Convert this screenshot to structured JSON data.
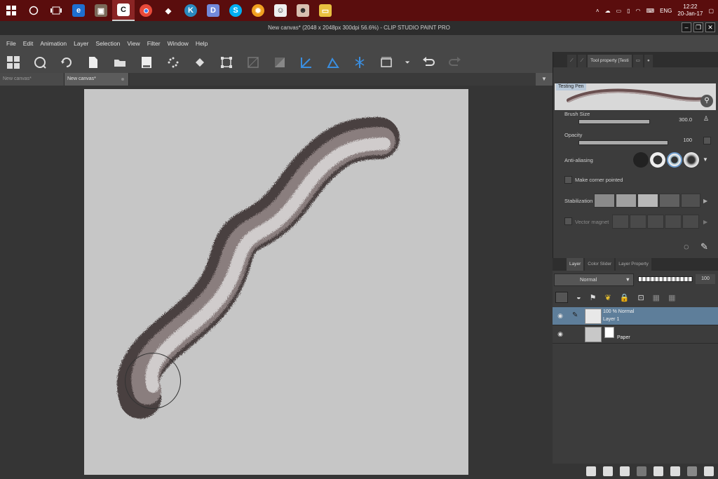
{
  "taskbar": {
    "icons": [
      "windows-start-icon",
      "cortana-icon",
      "task-view-icon",
      "edge-icon",
      "app-icon",
      "clip-studio-icon",
      "chrome-icon",
      "firefox-icon",
      "kodi-icon",
      "discord-icon",
      "skype-icon",
      "app2-icon",
      "app3-icon",
      "app4-icon",
      "explorer-icon"
    ],
    "lang": "ENG",
    "time": "12:22",
    "date": "20-Jan-17"
  },
  "window": {
    "title": "New canvas* (2048 x 2048px 300dpi 56.6%)  - CLIP STUDIO PAINT PRO"
  },
  "menu": [
    "File",
    "Edit",
    "Animation",
    "Layer",
    "Selection",
    "View",
    "Filter",
    "Window",
    "Help"
  ],
  "tabs": [
    {
      "label": "New canvas*"
    },
    {
      "label": "New canvas*"
    }
  ],
  "tool_property": {
    "tab_label": "Tool property [Testi",
    "brush_name": "Testing Pen",
    "brush_size_label": "Brush Size",
    "brush_size_value": "300.0",
    "brush_size_fraction": 1.0,
    "opacity_label": "Opacity",
    "opacity_value": "100",
    "opacity_fraction": 1.0,
    "anti_aliasing_label": "Anti-aliasing",
    "corner_label": "Make corner pointed",
    "stabilization_label": "Stabilization",
    "vector_label": "Vector magnet"
  },
  "layer_panel": {
    "tabs": [
      "Layer",
      "Color Slider",
      "Layer Property"
    ],
    "blend_mode": "Normal",
    "opacity": "100",
    "layers": [
      {
        "line1": "100 % Normal",
        "line2": "Layer 1"
      },
      {
        "line1": "",
        "line2": "Paper"
      }
    ]
  }
}
